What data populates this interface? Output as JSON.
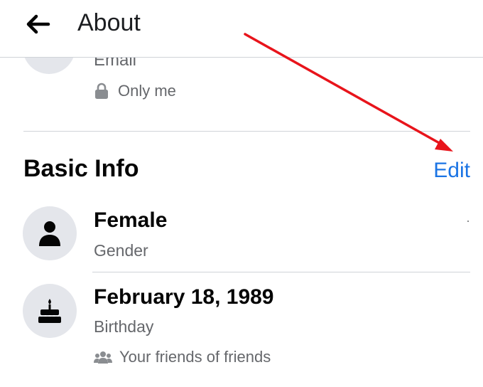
{
  "header": {
    "title": "About",
    "back_icon": "arrow-left-icon"
  },
  "contact": {
    "email_label": "Email",
    "privacy_text": "Only me",
    "privacy_icon": "lock-icon"
  },
  "basic_info": {
    "title": "Basic Info",
    "edit_label": "Edit",
    "gender": {
      "value": "Female",
      "label": "Gender",
      "icon": "person-icon"
    },
    "birthday": {
      "value": "February 18, 1989",
      "label": "Birthday",
      "icon": "birthday-cake-icon",
      "audience_text": "Your friends of friends",
      "audience_icon": "friends-icon"
    }
  },
  "annotation": {
    "arrow_color": "#e8141b",
    "arrow_icon": "red-arrow-annotation"
  },
  "colors": {
    "link": "#1b74e4",
    "secondary_text": "#65676b",
    "avatar_bg": "#e4e6eb"
  }
}
